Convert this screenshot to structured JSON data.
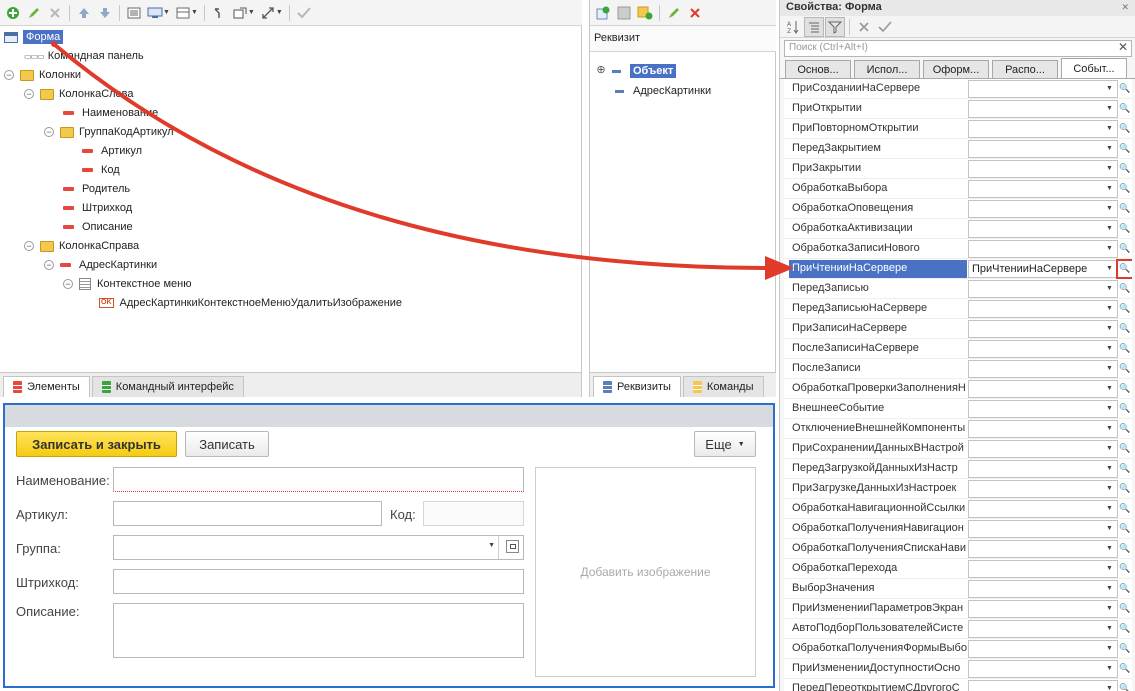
{
  "tree": {
    "nodes": [
      {
        "label": "Форма",
        "icon": "form-icon"
      },
      {
        "label": "Командная панель",
        "icon": "command-panel-icon"
      },
      {
        "label": "Колонки",
        "icon": "folder-icon"
      },
      {
        "label": "КолонкаСлева",
        "icon": "folder-icon"
      },
      {
        "label": "Наименование",
        "icon": "field-icon"
      },
      {
        "label": "ГруппаКодАртикул",
        "icon": "folder-icon"
      },
      {
        "label": "Артикул",
        "icon": "field-icon"
      },
      {
        "label": "Код",
        "icon": "field-icon"
      },
      {
        "label": "Родитель",
        "icon": "field-icon"
      },
      {
        "label": "Штрихкод",
        "icon": "field-icon"
      },
      {
        "label": "Описание",
        "icon": "field-icon"
      },
      {
        "label": "КолонкаСправа",
        "icon": "folder-icon"
      },
      {
        "label": "АдресКартинки",
        "icon": "field-icon"
      },
      {
        "label": "Контекстное меню",
        "icon": "context-menu-icon"
      },
      {
        "label": "АдресКартинкиКонтекстноеМенюУдалитьИзображение",
        "icon": "ok-command-icon"
      }
    ],
    "tabs": [
      "Элементы",
      "Командный интерфейс"
    ]
  },
  "requisites": {
    "header": "Реквизит",
    "items": [
      "Объект",
      "АдресКартинки"
    ],
    "tabs": [
      "Реквизиты",
      "Команды"
    ]
  },
  "form_preview": {
    "buttons": {
      "save_close": "Записать и закрыть",
      "save": "Записать",
      "more": "Еще"
    },
    "fields": {
      "name": "Наименование:",
      "article": "Артикул:",
      "code": "Код:",
      "group": "Группа:",
      "barcode": "Штрихкод:",
      "description": "Описание:"
    },
    "picture_placeholder": "Добавить изображение"
  },
  "properties": {
    "title": "Свойства: Форма",
    "search_placeholder": "Поиск (Ctrl+Alt+I)",
    "tabs": [
      "Основ...",
      "Испол...",
      "Оформ...",
      "Распо...",
      "Событ..."
    ],
    "active_tab": "Событ...",
    "events": [
      {
        "name": "ПриСозданииНаСервере",
        "value": ""
      },
      {
        "name": "ПриОткрытии",
        "value": ""
      },
      {
        "name": "ПриПовторномОткрытии",
        "value": ""
      },
      {
        "name": "ПередЗакрытием",
        "value": ""
      },
      {
        "name": "ПриЗакрытии",
        "value": ""
      },
      {
        "name": "ОбработкаВыбора",
        "value": ""
      },
      {
        "name": "ОбработкаОповещения",
        "value": ""
      },
      {
        "name": "ОбработкаАктивизации",
        "value": ""
      },
      {
        "name": "ОбработкаЗаписиНового",
        "value": ""
      },
      {
        "name": "ПриЧтенииНаСервере",
        "value": "ПриЧтенииНаСервере"
      },
      {
        "name": "ПередЗаписью",
        "value": ""
      },
      {
        "name": "ПередЗаписьюНаСервере",
        "value": ""
      },
      {
        "name": "ПриЗаписиНаСервере",
        "value": ""
      },
      {
        "name": "ПослеЗаписиНаСервере",
        "value": ""
      },
      {
        "name": "ПослеЗаписи",
        "value": ""
      },
      {
        "name": "ОбработкаПроверкиЗаполненияН",
        "value": ""
      },
      {
        "name": "ВнешнееСобытие",
        "value": ""
      },
      {
        "name": "ОтключениеВнешнейКомпоненты",
        "value": ""
      },
      {
        "name": "ПриСохраненииДанныхВНастрой",
        "value": ""
      },
      {
        "name": "ПередЗагрузкойДанныхИзНастр",
        "value": ""
      },
      {
        "name": "ПриЗагрузкеДанныхИзНастроек",
        "value": ""
      },
      {
        "name": "ОбработкаНавигационнойСсылки",
        "value": ""
      },
      {
        "name": "ОбработкаПолученияНавигацион",
        "value": ""
      },
      {
        "name": "ОбработкаПолученияСпискаНави",
        "value": ""
      },
      {
        "name": "ОбработкаПерехода",
        "value": ""
      },
      {
        "name": "ВыборЗначения",
        "value": ""
      },
      {
        "name": "ПриИзмененииПараметровЭкран",
        "value": ""
      },
      {
        "name": "АвтоПодборПользователейСисте",
        "value": ""
      },
      {
        "name": "ОбработкаПолученияФормыВыбо",
        "value": ""
      },
      {
        "name": "ПриИзмененииДоступностиОсно",
        "value": ""
      },
      {
        "name": "ПередПереоткрытиемСДругогоС",
        "value": ""
      }
    ],
    "selected_event": "ПриЧтенииНаСервере"
  },
  "colors": {
    "annotation_arrow": "#e03a2a",
    "selection": "#4a72c4",
    "primary_button": "#f5cc11",
    "preview_border": "#2a6fc9"
  }
}
